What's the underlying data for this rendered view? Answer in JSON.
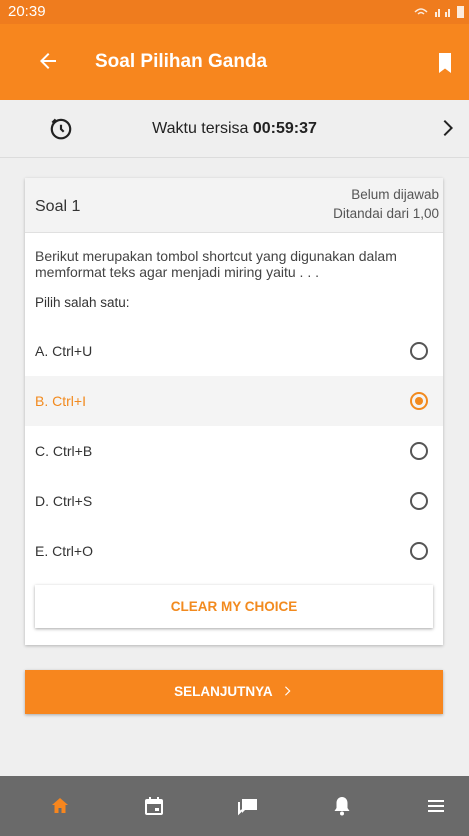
{
  "status_bar": {
    "time": "20:39",
    "indicators": "wifi signal battery"
  },
  "app_bar": {
    "title": "Soal Pilihan Ganda",
    "back_icon": "arrow-left-icon",
    "bookmark_icon": "bookmark-icon"
  },
  "timer": {
    "label": "Waktu tersisa ",
    "value": "00:59:37",
    "icon": "timer-icon"
  },
  "question": {
    "title": "Soal 1",
    "status_line1": "Belum dijawab",
    "status_line2": "Ditandai dari 1,00",
    "text": "Berikut merupakan tombol shortcut yang digunakan dalam memformat teks agar menjadi miring yaitu . . .",
    "instruction": "Pilih salah satu:",
    "options": [
      {
        "label": "A. Ctrl+U",
        "selected": false
      },
      {
        "label": "B. Ctrl+I",
        "selected": true
      },
      {
        "label": "C. Ctrl+B",
        "selected": false
      },
      {
        "label": "D. Ctrl+S",
        "selected": false
      },
      {
        "label": "E. Ctrl+O",
        "selected": false
      }
    ],
    "clear_label": "CLEAR MY CHOICE"
  },
  "next_label": "SELANJUTNYA",
  "bottom_nav": [
    "home-icon",
    "calendar-icon",
    "messages-icon",
    "notifications-icon",
    "menu-icon"
  ],
  "colors": {
    "accent": "#f7861e",
    "nav_bg": "#6a6a6a",
    "active_nav": "#f7861e"
  }
}
